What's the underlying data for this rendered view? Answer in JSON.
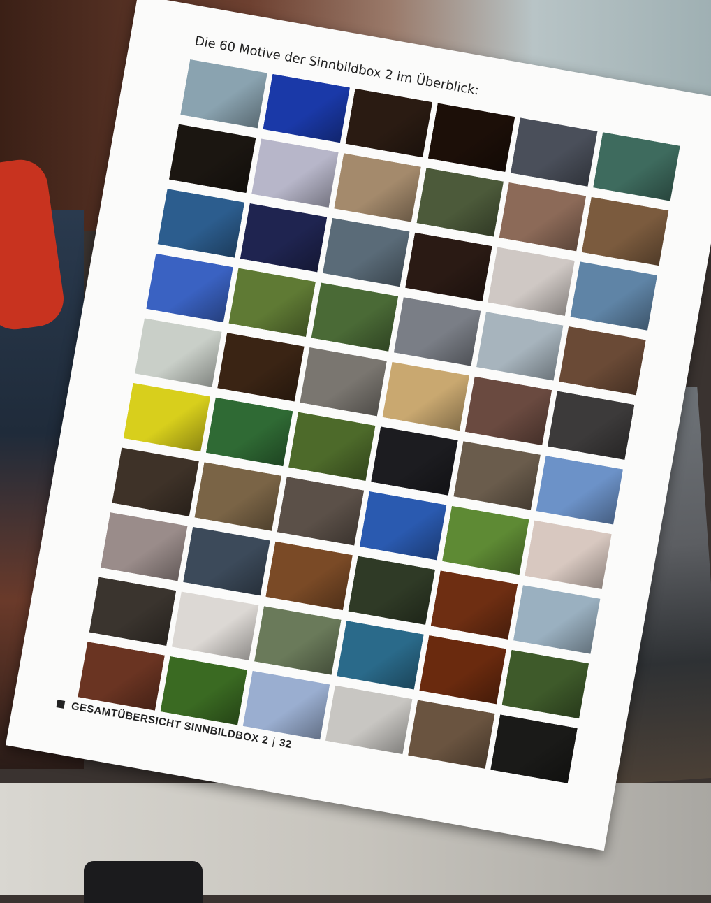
{
  "booklet": {
    "heading": "Die 60 Motive der Sinnbildbox 2 im Überblick:",
    "footer_section": "GESAMTÜBERSICHT SINNBILDBOX 2",
    "footer_separator": "|",
    "footer_page": "32"
  },
  "motif_colors": [
    "#8aa3b0",
    "#1a39a8",
    "#2a1b12",
    "#1c0f08",
    "#4a4f5a",
    "#3e6b5e",
    "#1b1611",
    "#b7b6c9",
    "#a48a6c",
    "#4c5a3a",
    "#8c6a58",
    "#7b5b3e",
    "#2c5d8e",
    "#1f2450",
    "#5a6b78",
    "#2a1a14",
    "#cfc8c4",
    "#5f84a6",
    "#3a62c2",
    "#5f7a34",
    "#4a6a36",
    "#7a7e86",
    "#a7b4bd",
    "#6a4a36",
    "#c9cfc8",
    "#3a2414",
    "#7a7670",
    "#c9a870",
    "#6a4a40",
    "#3c3a3a",
    "#d8cf1c",
    "#2f6a34",
    "#4d6a2a",
    "#1c1c20",
    "#6a5c4c",
    "#6c92c8",
    "#3e3228",
    "#7a6446",
    "#5b5048",
    "#2a5ab0",
    "#5e8a34",
    "#d8c8c0",
    "#9a8c8a",
    "#3c4a5a",
    "#7a4a26",
    "#2f3a26",
    "#6e2e12",
    "#9ab0c0",
    "#3a342e",
    "#dcd8d4",
    "#6a7a5a",
    "#2a6a8a",
    "#6a2a0e",
    "#3e5a2a",
    "#6a3422",
    "#3a6a22",
    "#9aaed0",
    "#c8c6c2",
    "#6a5440",
    "#1a1a18"
  ]
}
